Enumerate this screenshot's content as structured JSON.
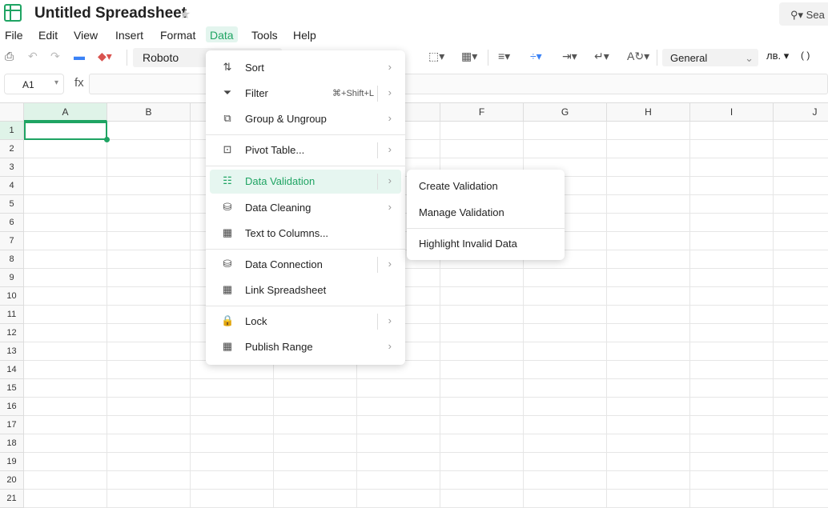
{
  "app": {
    "title": "Untitled Spreadsheet",
    "search_label": "Sea"
  },
  "menubar": [
    "File",
    "Edit",
    "View",
    "Insert",
    "Format",
    "Data",
    "Tools",
    "Help"
  ],
  "toolbar": {
    "font": "Roboto",
    "number_format": "General",
    "currency": "лв.",
    "parens": "( )"
  },
  "formula_bar": {
    "cell_ref": "A1",
    "fx": "fx",
    "value": ""
  },
  "grid": {
    "columns": [
      "A",
      "B",
      "C",
      "D",
      "E",
      "F",
      "G",
      "H",
      "I",
      "J"
    ],
    "rows": [
      "1",
      "2",
      "3",
      "4",
      "5",
      "6",
      "7",
      "8",
      "9",
      "10",
      "11",
      "12",
      "13",
      "14",
      "15",
      "16",
      "17",
      "18",
      "19",
      "20",
      "21"
    ],
    "selected": "A1",
    "accent": "#1fa463"
  },
  "data_menu": {
    "items": [
      {
        "label": "Sort",
        "icon": "sort-icon",
        "shortcut": "",
        "submenu": true
      },
      {
        "label": "Filter",
        "icon": "filter-icon",
        "shortcut": "⌘+Shift+L",
        "submenu": true
      },
      {
        "label": "Group & Ungroup",
        "icon": "group-icon",
        "shortcut": "",
        "submenu": true
      },
      {
        "label": "Pivot Table...",
        "icon": "pivot-table-icon",
        "shortcut": "",
        "submenu": true
      },
      {
        "label": "Data Validation",
        "icon": "data-validation-icon",
        "shortcut": "",
        "submenu": true
      },
      {
        "label": "Data Cleaning",
        "icon": "data-cleaning-icon",
        "shortcut": "",
        "submenu": true
      },
      {
        "label": "Text to Columns...",
        "icon": "text-to-columns-icon",
        "shortcut": "",
        "submenu": false
      },
      {
        "label": "Data Connection",
        "icon": "data-connection-icon",
        "shortcut": "",
        "submenu": true
      },
      {
        "label": "Link Spreadsheet",
        "icon": "link-spreadsheet-icon",
        "shortcut": "",
        "submenu": false
      },
      {
        "label": "Lock",
        "icon": "lock-icon",
        "shortcut": "",
        "submenu": true
      },
      {
        "label": "Publish Range",
        "icon": "publish-range-icon",
        "shortcut": "",
        "submenu": true
      }
    ]
  },
  "validation_submenu": [
    "Create Validation",
    "Manage Validation",
    "Highlight Invalid Data"
  ]
}
